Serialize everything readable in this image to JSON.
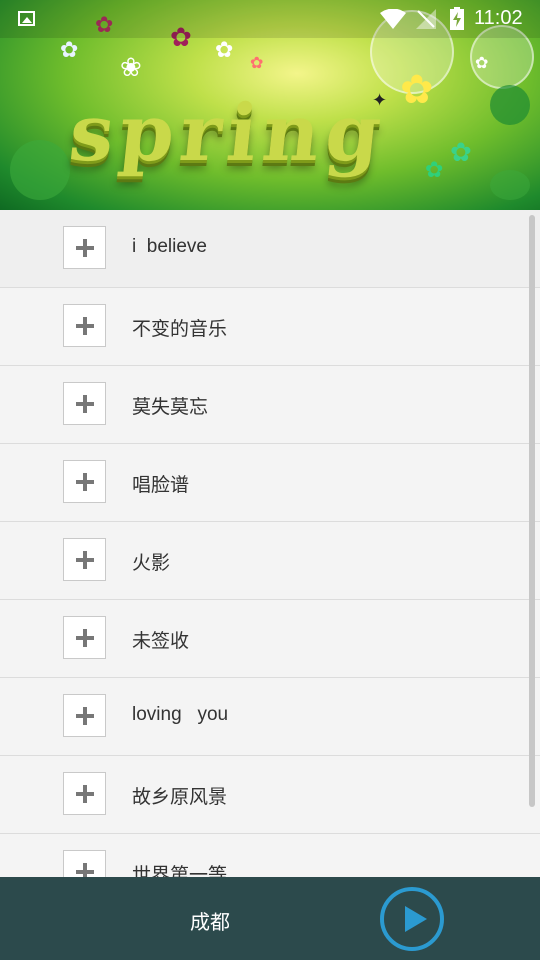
{
  "status_bar": {
    "time": "11:02",
    "icons": [
      "image-icon",
      "wifi-icon",
      "signal-icon",
      "battery-charging-icon"
    ]
  },
  "banner": {
    "title": "spring"
  },
  "songs": [
    {
      "title": "i  believe"
    },
    {
      "title": "不变的音乐"
    },
    {
      "title": "莫失莫忘"
    },
    {
      "title": "唱脸谱"
    },
    {
      "title": "火影"
    },
    {
      "title": "未签收"
    },
    {
      "title": "loving   you"
    },
    {
      "title": "故乡原风景"
    },
    {
      "title": "世界第一等"
    }
  ],
  "player": {
    "city": "成都",
    "play_icon": "play-icon"
  },
  "colors": {
    "bottom_bar": "#2c4a4c",
    "play_accent": "#2b9ad0"
  }
}
